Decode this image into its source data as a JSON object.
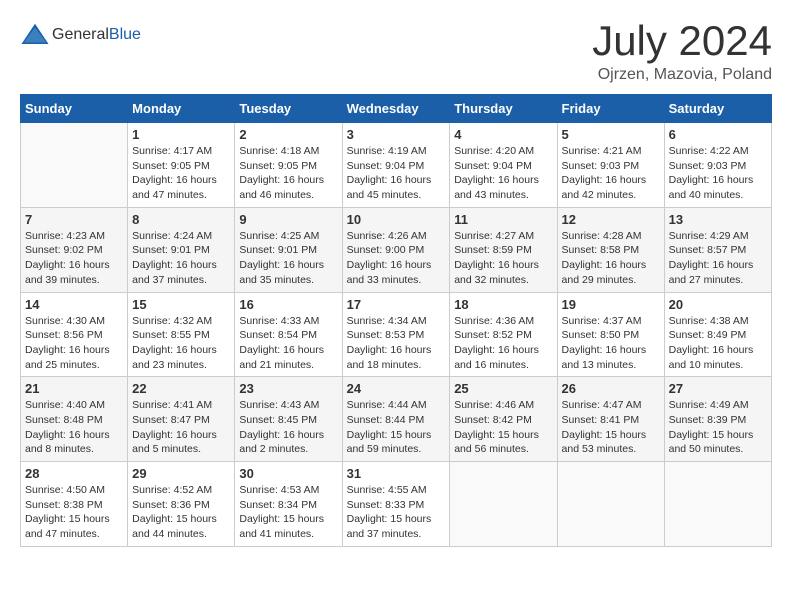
{
  "header": {
    "logo_general": "General",
    "logo_blue": "Blue",
    "month_year": "July 2024",
    "location": "Ojrzen, Mazovia, Poland"
  },
  "days_of_week": [
    "Sunday",
    "Monday",
    "Tuesday",
    "Wednesday",
    "Thursday",
    "Friday",
    "Saturday"
  ],
  "weeks": [
    [
      {
        "day": "",
        "info": ""
      },
      {
        "day": "1",
        "info": "Sunrise: 4:17 AM\nSunset: 9:05 PM\nDaylight: 16 hours\nand 47 minutes."
      },
      {
        "day": "2",
        "info": "Sunrise: 4:18 AM\nSunset: 9:05 PM\nDaylight: 16 hours\nand 46 minutes."
      },
      {
        "day": "3",
        "info": "Sunrise: 4:19 AM\nSunset: 9:04 PM\nDaylight: 16 hours\nand 45 minutes."
      },
      {
        "day": "4",
        "info": "Sunrise: 4:20 AM\nSunset: 9:04 PM\nDaylight: 16 hours\nand 43 minutes."
      },
      {
        "day": "5",
        "info": "Sunrise: 4:21 AM\nSunset: 9:03 PM\nDaylight: 16 hours\nand 42 minutes."
      },
      {
        "day": "6",
        "info": "Sunrise: 4:22 AM\nSunset: 9:03 PM\nDaylight: 16 hours\nand 40 minutes."
      }
    ],
    [
      {
        "day": "7",
        "info": "Sunrise: 4:23 AM\nSunset: 9:02 PM\nDaylight: 16 hours\nand 39 minutes."
      },
      {
        "day": "8",
        "info": "Sunrise: 4:24 AM\nSunset: 9:01 PM\nDaylight: 16 hours\nand 37 minutes."
      },
      {
        "day": "9",
        "info": "Sunrise: 4:25 AM\nSunset: 9:01 PM\nDaylight: 16 hours\nand 35 minutes."
      },
      {
        "day": "10",
        "info": "Sunrise: 4:26 AM\nSunset: 9:00 PM\nDaylight: 16 hours\nand 33 minutes."
      },
      {
        "day": "11",
        "info": "Sunrise: 4:27 AM\nSunset: 8:59 PM\nDaylight: 16 hours\nand 32 minutes."
      },
      {
        "day": "12",
        "info": "Sunrise: 4:28 AM\nSunset: 8:58 PM\nDaylight: 16 hours\nand 29 minutes."
      },
      {
        "day": "13",
        "info": "Sunrise: 4:29 AM\nSunset: 8:57 PM\nDaylight: 16 hours\nand 27 minutes."
      }
    ],
    [
      {
        "day": "14",
        "info": "Sunrise: 4:30 AM\nSunset: 8:56 PM\nDaylight: 16 hours\nand 25 minutes."
      },
      {
        "day": "15",
        "info": "Sunrise: 4:32 AM\nSunset: 8:55 PM\nDaylight: 16 hours\nand 23 minutes."
      },
      {
        "day": "16",
        "info": "Sunrise: 4:33 AM\nSunset: 8:54 PM\nDaylight: 16 hours\nand 21 minutes."
      },
      {
        "day": "17",
        "info": "Sunrise: 4:34 AM\nSunset: 8:53 PM\nDaylight: 16 hours\nand 18 minutes."
      },
      {
        "day": "18",
        "info": "Sunrise: 4:36 AM\nSunset: 8:52 PM\nDaylight: 16 hours\nand 16 minutes."
      },
      {
        "day": "19",
        "info": "Sunrise: 4:37 AM\nSunset: 8:50 PM\nDaylight: 16 hours\nand 13 minutes."
      },
      {
        "day": "20",
        "info": "Sunrise: 4:38 AM\nSunset: 8:49 PM\nDaylight: 16 hours\nand 10 minutes."
      }
    ],
    [
      {
        "day": "21",
        "info": "Sunrise: 4:40 AM\nSunset: 8:48 PM\nDaylight: 16 hours\nand 8 minutes."
      },
      {
        "day": "22",
        "info": "Sunrise: 4:41 AM\nSunset: 8:47 PM\nDaylight: 16 hours\nand 5 minutes."
      },
      {
        "day": "23",
        "info": "Sunrise: 4:43 AM\nSunset: 8:45 PM\nDaylight: 16 hours\nand 2 minutes."
      },
      {
        "day": "24",
        "info": "Sunrise: 4:44 AM\nSunset: 8:44 PM\nDaylight: 15 hours\nand 59 minutes."
      },
      {
        "day": "25",
        "info": "Sunrise: 4:46 AM\nSunset: 8:42 PM\nDaylight: 15 hours\nand 56 minutes."
      },
      {
        "day": "26",
        "info": "Sunrise: 4:47 AM\nSunset: 8:41 PM\nDaylight: 15 hours\nand 53 minutes."
      },
      {
        "day": "27",
        "info": "Sunrise: 4:49 AM\nSunset: 8:39 PM\nDaylight: 15 hours\nand 50 minutes."
      }
    ],
    [
      {
        "day": "28",
        "info": "Sunrise: 4:50 AM\nSunset: 8:38 PM\nDaylight: 15 hours\nand 47 minutes."
      },
      {
        "day": "29",
        "info": "Sunrise: 4:52 AM\nSunset: 8:36 PM\nDaylight: 15 hours\nand 44 minutes."
      },
      {
        "day": "30",
        "info": "Sunrise: 4:53 AM\nSunset: 8:34 PM\nDaylight: 15 hours\nand 41 minutes."
      },
      {
        "day": "31",
        "info": "Sunrise: 4:55 AM\nSunset: 8:33 PM\nDaylight: 15 hours\nand 37 minutes."
      },
      {
        "day": "",
        "info": ""
      },
      {
        "day": "",
        "info": ""
      },
      {
        "day": "",
        "info": ""
      }
    ]
  ]
}
